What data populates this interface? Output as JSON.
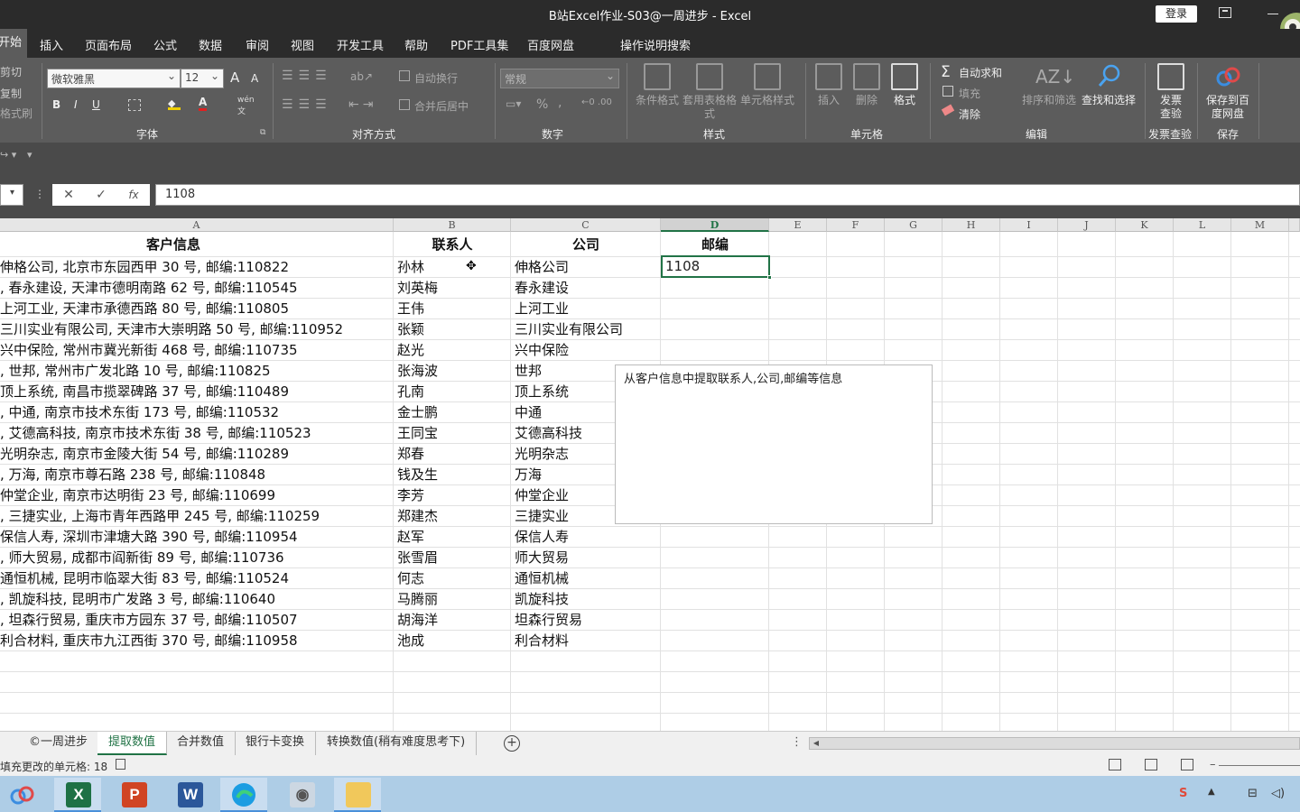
{
  "window": {
    "title": "B站Excel作业-S03@一周进步  -  Excel",
    "login": "登录"
  },
  "tabs": [
    "开始",
    "插入",
    "页面布局",
    "公式",
    "数据",
    "审阅",
    "视图",
    "开发工具",
    "帮助",
    "PDF工具集",
    "百度网盘",
    "操作说明搜索"
  ],
  "ribbon": {
    "clipboard": {
      "cut": "剪切",
      "copy": "复制",
      "painter": "格式刷"
    },
    "font": {
      "name": "微软雅黑",
      "size": "12",
      "grow": "A",
      "shrink": "A",
      "bold": "B",
      "italic": "I",
      "underline": "U",
      "wen": "wén",
      "wen2": "文",
      "label": "字体"
    },
    "align": {
      "wrap": "自动换行",
      "merge": "合并后居中",
      "label": "对齐方式"
    },
    "number": {
      "format": "常规",
      "percent": "%",
      "comma": ",",
      "label": "数字"
    },
    "styles": {
      "cond": "条件格式",
      "table": "套用表格格式",
      "cell": "单元格样式",
      "label": "样式"
    },
    "cells": {
      "insert": "插入",
      "delete": "删除",
      "format": "格式",
      "label": "单元格"
    },
    "editing": {
      "autosum": "自动求和",
      "fill": "填充",
      "clear": "清除",
      "sort": "排序和筛选",
      "find": "查找和选择",
      "label": "编辑"
    },
    "invoice": {
      "btn": "发票查验",
      "label": "发票查验"
    },
    "save": {
      "btn": "保存到百度网盘",
      "label": "保存"
    }
  },
  "formula_bar": {
    "value": "1108",
    "cancel": "✕",
    "enter": "✓",
    "fx": "fx"
  },
  "columns": [
    "A",
    "B",
    "C",
    "D",
    "E",
    "F",
    "G",
    "H",
    "I",
    "J",
    "K",
    "L",
    "M"
  ],
  "headers": {
    "a": "客户信息",
    "b": "联系人",
    "c": "公司",
    "d": "邮编"
  },
  "rows": [
    {
      "a": "伸格公司, 北京市东园西甲 30 号, 邮编:110822",
      "b": "孙林",
      "c": "伸格公司"
    },
    {
      "a": ", 春永建设, 天津市德明南路 62 号, 邮编:110545",
      "b": "刘英梅",
      "c": "春永建设"
    },
    {
      "a": "上河工业, 天津市承德西路 80 号, 邮编:110805",
      "b": "王伟",
      "c": "上河工业"
    },
    {
      "a": "三川实业有限公司, 天津市大崇明路 50 号, 邮编:110952",
      "b": "张颖",
      "c": "三川实业有限公司"
    },
    {
      "a": "兴中保险, 常州市冀光新街 468 号, 邮编:110735",
      "b": "赵光",
      "c": "兴中保险"
    },
    {
      "a": ", 世邦, 常州市广发北路 10 号, 邮编:110825",
      "b": "张海波",
      "c": "世邦"
    },
    {
      "a": "顶上系统, 南昌市揽翠碑路 37 号, 邮编:110489",
      "b": "孔南",
      "c": "顶上系统"
    },
    {
      "a": ", 中通, 南京市技术东街 173 号, 邮编:110532",
      "b": "金士鹏",
      "c": "中通"
    },
    {
      "a": ", 艾德高科技, 南京市技术东街 38 号, 邮编:110523",
      "b": "王同宝",
      "c": "艾德高科技"
    },
    {
      "a": "光明杂志, 南京市金陵大街 54 号, 邮编:110289",
      "b": "郑春",
      "c": "光明杂志"
    },
    {
      "a": ", 万海, 南京市尊石路 238 号, 邮编:110848",
      "b": "钱及生",
      "c": "万海"
    },
    {
      "a": "仲堂企业, 南京市达明街 23 号, 邮编:110699",
      "b": "李芳",
      "c": "仲堂企业"
    },
    {
      "a": ", 三捷实业, 上海市青年西路甲 245 号, 邮编:110259",
      "b": "郑建杰",
      "c": "三捷实业"
    },
    {
      "a": "保信人寿, 深圳市津塘大路 390 号, 邮编:110954",
      "b": "赵军",
      "c": "保信人寿"
    },
    {
      "a": ", 师大贸易, 成都市阎新街 89 号, 邮编:110736",
      "b": "张雪眉",
      "c": "师大贸易"
    },
    {
      "a": "通恒机械, 昆明市临翠大街 83 号, 邮编:110524",
      "b": "何志",
      "c": "通恒机械"
    },
    {
      "a": ", 凯旋科技, 昆明市广发路 3 号, 邮编:110640",
      "b": "马腾丽",
      "c": "凯旋科技"
    },
    {
      "a": ", 坦森行贸易, 重庆市方园东 37 号, 邮编:110507",
      "b": "胡海洋",
      "c": "坦森行贸易"
    },
    {
      "a": "利合材料, 重庆市九江西街 370 号, 邮编:110958",
      "b": "池成",
      "c": "利合材料"
    }
  ],
  "active_cell": {
    "value": "1108"
  },
  "note": "从客户信息中提取联系人,公司,邮编等信息",
  "sheets": [
    "©一周进步",
    "提取数值",
    "合并数值",
    "银行卡变换",
    "转换数值(稍有难度思考下)"
  ],
  "active_sheet": 1,
  "status": "填充更改的单元格: 18",
  "taskbar": [
    "百度网盘",
    "Excel",
    "PowerPoint",
    "Word",
    "Edge",
    "Photos",
    "文件资源管理器"
  ],
  "colors": {
    "excel_green": "#217346",
    "ribbon_bg": "#5c5c5c",
    "title_bg": "#2b2b2b"
  }
}
